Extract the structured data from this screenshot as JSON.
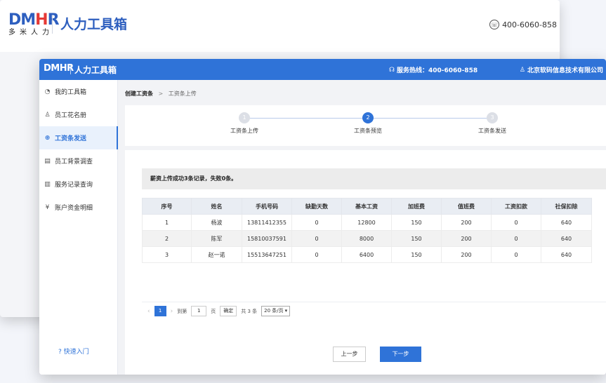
{
  "back": {
    "logo_mark": "DMHR",
    "logo_sub": "多米人力",
    "title": "人力工具箱",
    "phone": "400-6060-858"
  },
  "topbar": {
    "logo": "DMHR",
    "title": "人力工具箱",
    "hotline": "服务热线：400-6060-858",
    "company": "北京软码信息技术有限公司"
  },
  "sidebar": {
    "items": [
      {
        "label": "我的工具箱",
        "icon": "dashboard-icon"
      },
      {
        "label": "员工花名册",
        "icon": "person-icon"
      },
      {
        "label": "工资条发送",
        "icon": "plus-circle-icon"
      },
      {
        "label": "员工背景调查",
        "icon": "clipboard-icon"
      },
      {
        "label": "服务记录查询",
        "icon": "document-icon"
      },
      {
        "label": "账户资金明细",
        "icon": "yen-icon"
      }
    ],
    "help": "? 快速入门"
  },
  "breadcrumb": {
    "current": "创建工资条",
    "sep": ">",
    "sub": "工资条上传"
  },
  "steps": [
    {
      "num": "1",
      "label": "工资条上传"
    },
    {
      "num": "2",
      "label": "工资条预览"
    },
    {
      "num": "3",
      "label": "工资条发送"
    }
  ],
  "notice": "薪资上传成功3条记录，失败0条。",
  "table": {
    "headers": [
      "序号",
      "姓名",
      "手机号码",
      "缺勤天数",
      "基本工资",
      "加班费",
      "值班费",
      "工资扣款",
      "社保扣除"
    ],
    "rows": [
      [
        "1",
        "杨波",
        "13811412355",
        "0",
        "12800",
        "150",
        "200",
        "0",
        "640"
      ],
      [
        "2",
        "陈军",
        "15810037591",
        "0",
        "8000",
        "150",
        "200",
        "0",
        "640"
      ],
      [
        "3",
        "赵一诺",
        "15513647251",
        "0",
        "6400",
        "150",
        "200",
        "0",
        "640"
      ]
    ]
  },
  "pager": {
    "prev": "‹",
    "page": "1",
    "next": "›",
    "goto_label": "到第",
    "goto_value": "1",
    "page_unit": "页",
    "confirm": "确定",
    "total": "共 3 条",
    "page_size": "20 条/页"
  },
  "buttons": {
    "prev": "上一步",
    "next": "下一步"
  },
  "colors": {
    "brand_blue": "#2f73d8",
    "accent_red": "#e53935"
  }
}
